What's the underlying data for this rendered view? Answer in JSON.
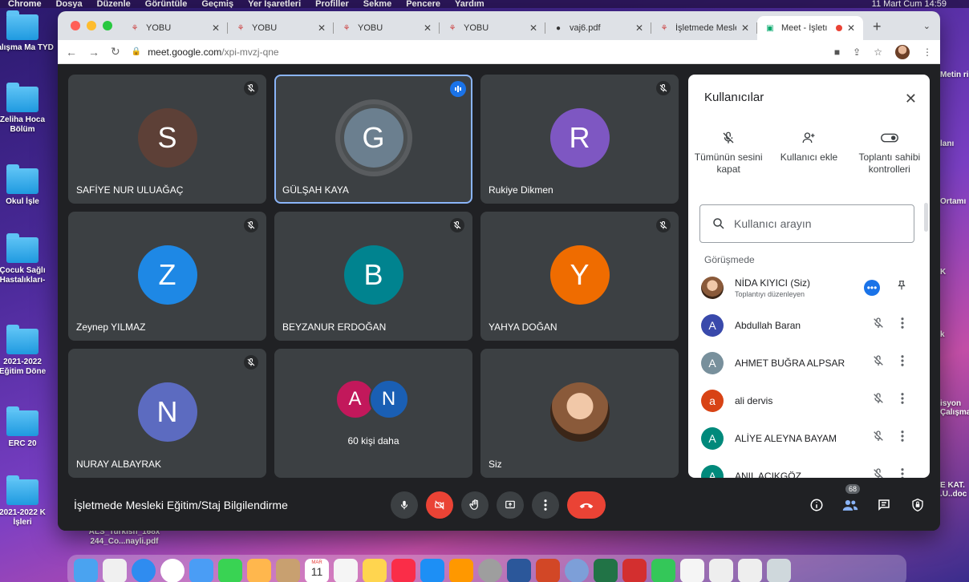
{
  "menubar": {
    "items": [
      "Chrome",
      "Dosya",
      "Düzenle",
      "Görüntüle",
      "Geçmiş",
      "Yer İşaretleri",
      "Profiller",
      "Sekme",
      "Pencere",
      "Yardım"
    ],
    "clock": "11 Mart Cum  14:59"
  },
  "desktop": {
    "left_items": [
      "Çalışma Ma TYD",
      "Zeliha Hoca Bölüm",
      "Okul İşle",
      "Çocuk Sağlı Hastalıkları-",
      "2021-2022 Eğitim Döne",
      "ERC 20",
      "2021-2022 K İşleri"
    ],
    "right_items": [
      "Metin ri",
      "lanı",
      "Ortamı",
      "K",
      "k",
      "isyon Çalışma",
      "E KAT. .U..doc"
    ],
    "bottom_file": "ALS_Turkish_168x 244_Co...nayli.pdf"
  },
  "browser": {
    "tabs": [
      {
        "title": "YOBU",
        "active": false
      },
      {
        "title": "YOBU",
        "active": false
      },
      {
        "title": "YOBU",
        "active": false
      },
      {
        "title": "YOBU",
        "active": false
      },
      {
        "title": "vaj6.pdf",
        "active": false
      },
      {
        "title": "İşletmede Mesle",
        "active": false
      },
      {
        "title": "Meet - İşletı",
        "active": true
      }
    ],
    "url_host": "meet.google.com",
    "url_path": "/xpi-mvzj-qne"
  },
  "tiles": [
    {
      "initial": "S",
      "name": "SAFİYE NUR ULUAĞAÇ",
      "color": "#5d4037",
      "muted": true,
      "speaking": false
    },
    {
      "initial": "G",
      "name": "GÜLŞAH KAYA",
      "color": "#6b7f8f",
      "muted": false,
      "speaking": true
    },
    {
      "initial": "R",
      "name": "Rukiye Dikmen",
      "color": "#7e57c2",
      "muted": true,
      "speaking": false
    },
    {
      "initial": "Z",
      "name": "Zeynep YILMAZ",
      "color": "#1e88e5",
      "muted": true,
      "speaking": false
    },
    {
      "initial": "B",
      "name": "BEYZANUR ERDOĞAN",
      "color": "#00838f",
      "muted": true,
      "speaking": false
    },
    {
      "initial": "Y",
      "name": "YAHYA DOĞAN",
      "color": "#ef6c00",
      "muted": true,
      "speaking": false
    },
    {
      "initial": "N",
      "name": "NURAY ALBAYRAK",
      "color": "#5c6bc0",
      "muted": true,
      "speaking": false
    }
  ],
  "more_tile": {
    "a1": "A",
    "a2": "N",
    "text": "60 kişi daha"
  },
  "self_tile": {
    "name": "Siz"
  },
  "bottom": {
    "meeting_title": "İşletmede Mesleki Eğitim/Staj Bilgilendirme",
    "people_count": "68"
  },
  "panel": {
    "title": "Kullanıcılar",
    "actions": [
      {
        "label": "Tümünün sesini kapat"
      },
      {
        "label": "Kullanıcı ekle"
      },
      {
        "label": "Toplantı sahibi kontrolleri"
      }
    ],
    "search_placeholder": "Kullanıcı arayın",
    "section": "Görüşmede",
    "participants": [
      {
        "initial": "",
        "name": "NİDA KIYICI (Siz)",
        "sub": "Toplantıyı düzenleyen",
        "color": "#8a5a3a",
        "self": true
      },
      {
        "initial": "A",
        "name": "Abdullah Baran",
        "sub": "",
        "color": "#3949ab",
        "self": false
      },
      {
        "initial": "A",
        "name": "AHMET BUĞRA ALPSAR",
        "sub": "",
        "color": "#78909c",
        "self": false
      },
      {
        "initial": "a",
        "name": "ali dervis",
        "sub": "",
        "color": "#d84315",
        "self": false
      },
      {
        "initial": "A",
        "name": "ALİYE ALEYNA BAYAM",
        "sub": "",
        "color": "#00897b",
        "self": false
      },
      {
        "initial": "A",
        "name": "ANIL AÇIKGÖZ",
        "sub": "",
        "color": "#00897b",
        "self": false
      }
    ]
  },
  "dock_icons": [
    "finder-icon",
    "launchpad-icon",
    "safari-icon",
    "chrome-icon",
    "mail-icon",
    "messages-icon",
    "photos-icon",
    "contacts-icon",
    "calendar-icon",
    "reminders-icon",
    "notes-icon",
    "music-icon",
    "appstore-icon",
    "pages-icon",
    "settings-icon",
    "word-icon",
    "powerpoint-icon",
    "math-icon",
    "excel-icon",
    "acrobat-icon",
    "facetime-icon",
    "document-icon",
    "document2-icon",
    "document3-icon",
    "trash-icon"
  ],
  "calendar_month": "MAR",
  "calendar_day": "11"
}
